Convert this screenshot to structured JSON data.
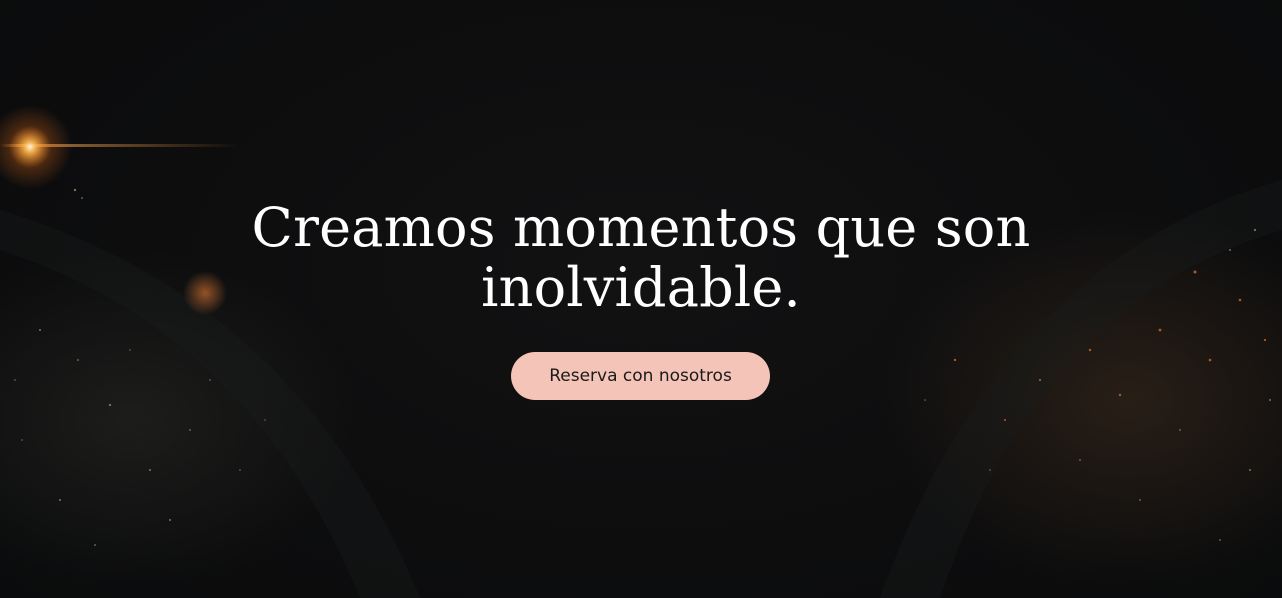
{
  "hero": {
    "headline": "Creamos momentos que son inolvidable.",
    "cta_label": "Reserva con nosotros"
  },
  "theme": {
    "background": "#0c0c0d",
    "text": "#ffffff",
    "cta_background": "#f4c4b8",
    "cta_text": "#1a1a1a",
    "glow": "#ff9a3c"
  }
}
